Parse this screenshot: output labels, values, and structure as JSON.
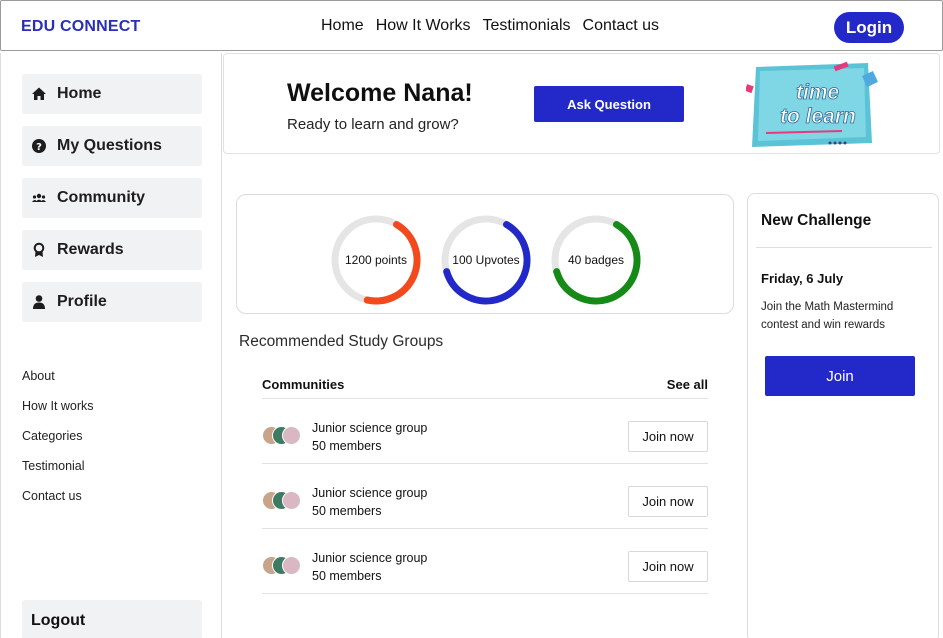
{
  "header": {
    "brand": "EDU CONNECT",
    "nav": [
      "Home",
      "How It Works",
      "Testimonials",
      "Contact us"
    ],
    "login_label": "Login"
  },
  "sidebar": {
    "items": [
      {
        "label": "Home",
        "icon": "home-icon"
      },
      {
        "label": "My Questions",
        "icon": "question-circle-icon"
      },
      {
        "label": "Community",
        "icon": "users-icon"
      },
      {
        "label": "Rewards",
        "icon": "award-icon"
      },
      {
        "label": "Profile",
        "icon": "user-icon"
      }
    ],
    "links": [
      "About",
      "How It works",
      "Categories",
      "Testimonial",
      "Contact us"
    ],
    "logout_label": "Logout"
  },
  "welcome": {
    "title": "Welcome Nana!",
    "subtitle": "Ready to learn and grow?",
    "ask_label": "Ask Question",
    "image_text": "time to learn"
  },
  "stats": [
    {
      "label": "1200 points",
      "color": "#f24a1d",
      "fill": 0.45
    },
    {
      "label": "100 Upvotes",
      "color": "#2329c9",
      "fill": 0.62
    },
    {
      "label": "40 badges",
      "color": "#168a16",
      "fill": 0.62
    }
  ],
  "groups": {
    "title": "Recommended Study Groups",
    "header_label": "Communities",
    "see_all_label": "See all",
    "rows": [
      {
        "name": "Junior science group",
        "members": "50 members",
        "join_label": "Join now"
      },
      {
        "name": "Junior science group",
        "members": "50 members",
        "join_label": "Join now"
      },
      {
        "name": "Junior science group",
        "members": "50 members",
        "join_label": "Join now"
      }
    ]
  },
  "challenge": {
    "title": "New Challenge",
    "date": "Friday, 6 July",
    "description": "Join the Math Mastermind contest and win rewards",
    "join_label": "Join"
  },
  "colors": {
    "accent": "#2329c9",
    "brand": "#2a2fb8"
  }
}
